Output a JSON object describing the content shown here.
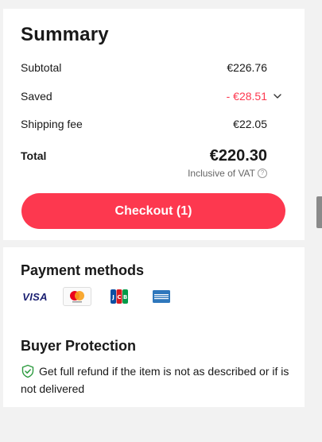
{
  "summary": {
    "title": "Summary",
    "subtotal_label": "Subtotal",
    "subtotal_value": "€226.76",
    "saved_label": "Saved",
    "saved_value": "- €28.51",
    "shipping_label": "Shipping fee",
    "shipping_value": "€22.05",
    "total_label": "Total",
    "total_value": "€220.30",
    "vat_note": "Inclusive of VAT",
    "checkout_label": "Checkout (1)"
  },
  "payment": {
    "title": "Payment methods",
    "methods": [
      {
        "name": "VISA",
        "icon": "visa-icon"
      },
      {
        "name": "Mastercard",
        "icon": "mastercard-icon"
      },
      {
        "name": "JCB",
        "icon": "jcb-icon"
      },
      {
        "name": "American Express",
        "icon": "amex-icon"
      }
    ]
  },
  "protection": {
    "title": "Buyer Protection",
    "text": "Get full refund if the item is not as described or if is not delivered"
  },
  "colors": {
    "accent": "#fd384f",
    "background": "#f2f2f2",
    "card": "#ffffff",
    "shield": "#2b9a3e"
  }
}
